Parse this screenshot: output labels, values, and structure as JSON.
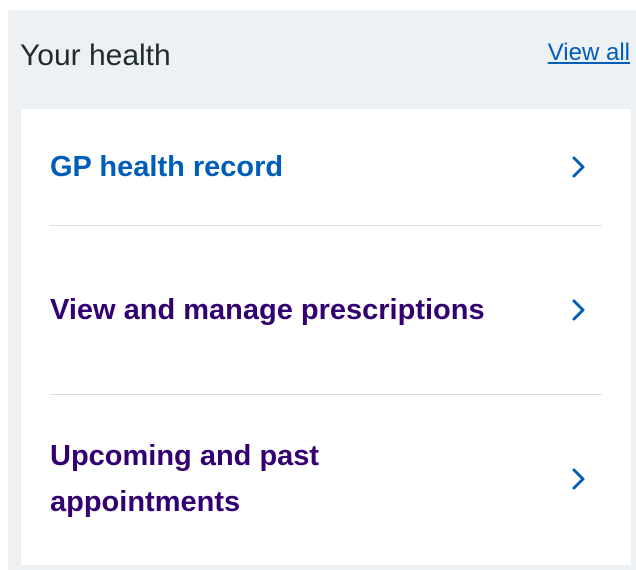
{
  "section": {
    "title": "Your health",
    "view_all_label": "View all"
  },
  "items": [
    {
      "label": "GP health record",
      "state": "current",
      "icon": "chevron-right-icon"
    },
    {
      "label": "View and manage prescriptions",
      "state": "visited",
      "icon": "chevron-right-icon"
    },
    {
      "label": "Upcoming and past appointments",
      "state": "visited",
      "icon": "chevron-right-icon"
    }
  ],
  "colors": {
    "section_background": "#eef1f3",
    "card_background": "#ffffff",
    "title_text": "#212b32",
    "link": "#005eb8",
    "visited_link": "#330072",
    "divider": "#d8dde0"
  }
}
